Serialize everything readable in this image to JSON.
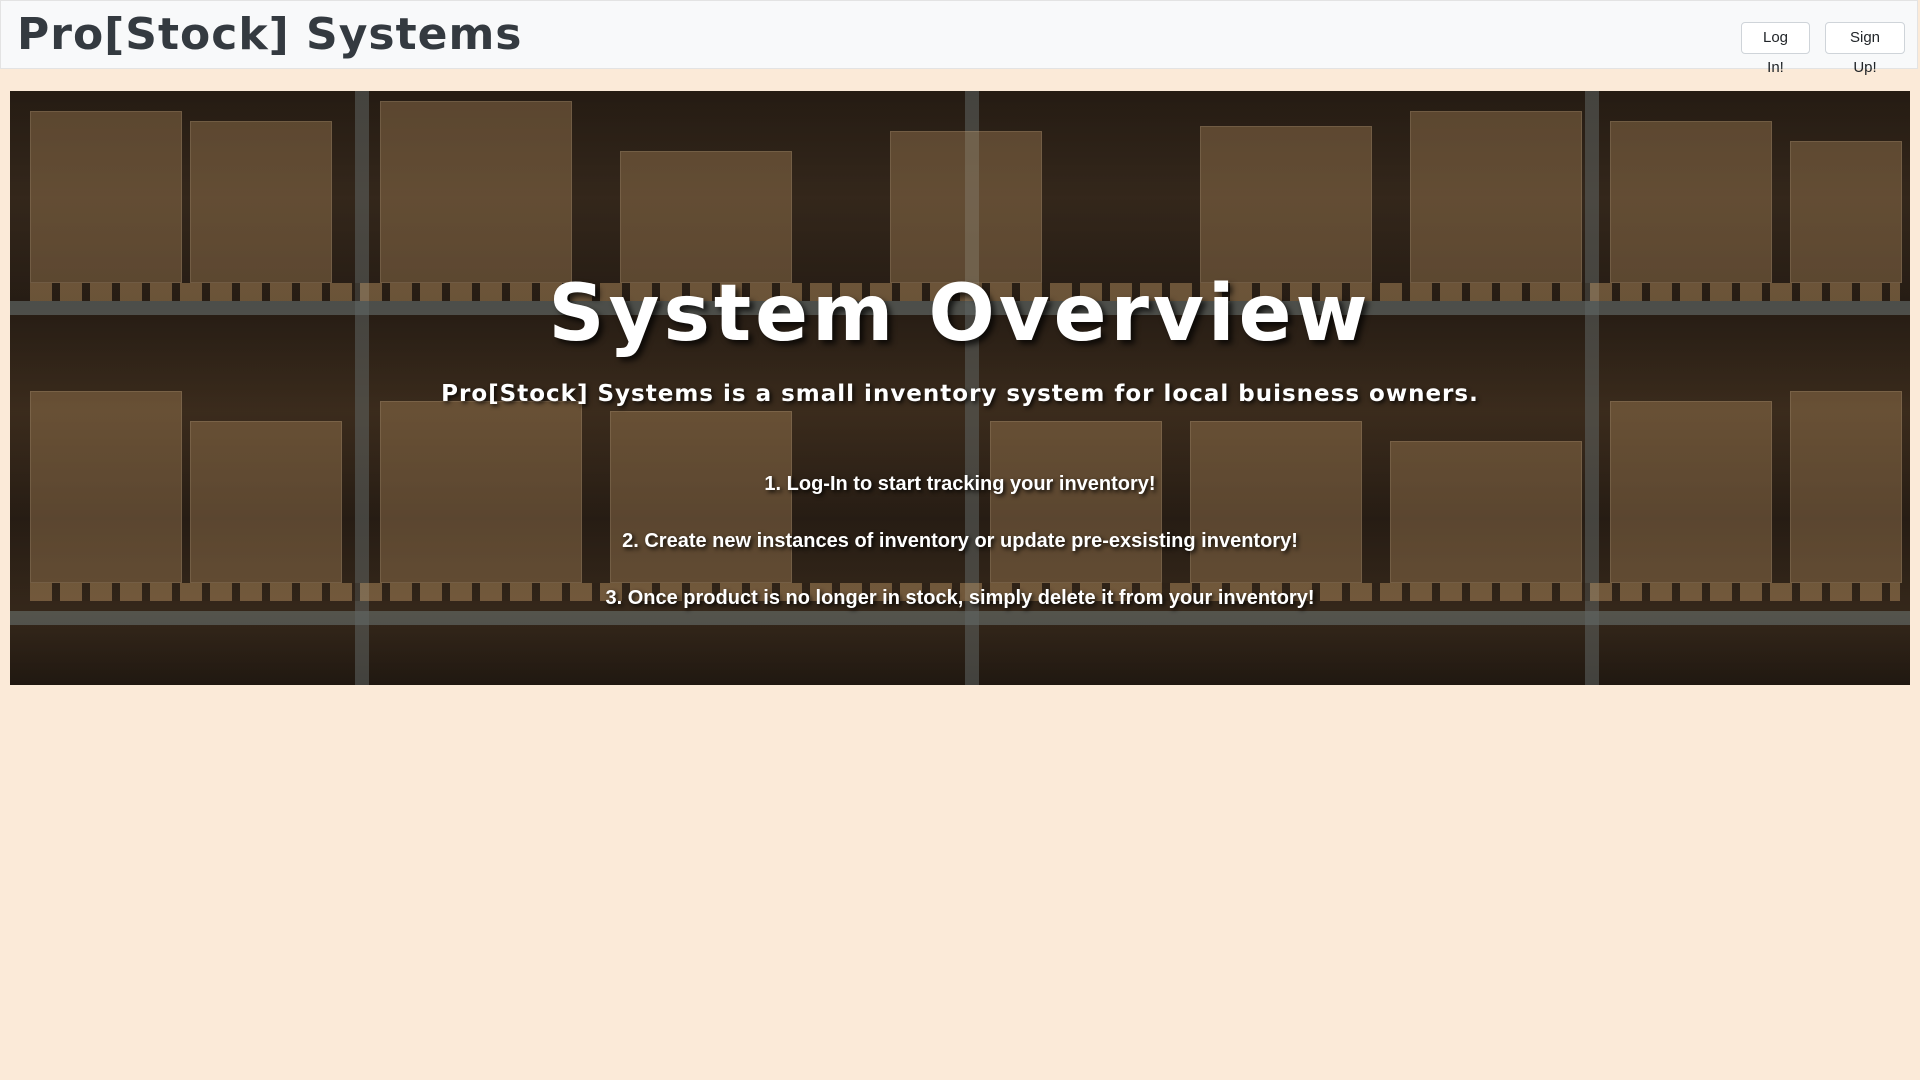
{
  "navbar": {
    "brand": "Pro[Stock] Systems",
    "login_label": "Log In!",
    "signup_label": "Sign Up!"
  },
  "hero": {
    "title": "System Overview",
    "subtitle": "Pro[Stock] Systems is a small inventory system for local buisness owners.",
    "steps": [
      "1. Log-In to start tracking your inventory!",
      "2. Create new instances of inventory or update pre-exsisting inventory!",
      "3. Once product is no longer in stock, simply delete it from your inventory!"
    ],
    "background": "warehouse-shelves-image"
  },
  "colors": {
    "page_background": "#fbead8",
    "navbar_background": "#f8f9fa",
    "brand_text": "#343a40",
    "hero_text": "#ffffff"
  }
}
